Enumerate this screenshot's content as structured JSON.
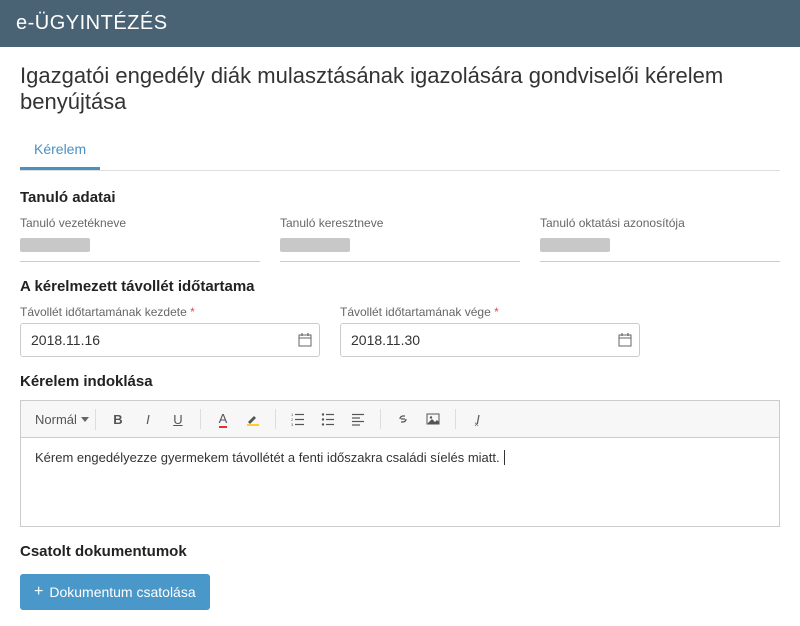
{
  "header": {
    "title": "e-ÜGYINTÉZÉS"
  },
  "page": {
    "title": "Igazgatói engedély diák mulasztásának igazolására gondviselői kérelem benyújtása"
  },
  "tabs": {
    "items": [
      {
        "label": "Kérelem",
        "active": true
      }
    ]
  },
  "student": {
    "section_title": "Tanuló adatai",
    "lastname_label": "Tanuló vezetékneve",
    "firstname_label": "Tanuló keresztneve",
    "eduId_label": "Tanuló oktatási azonosítója"
  },
  "absence": {
    "section_title": "A kérelmezett távollét időtartama",
    "start_label": "Távollét időtartamának kezdete",
    "end_label": "Távollét időtartamának vége",
    "start_value": "2018.11.16",
    "end_value": "2018.11.30"
  },
  "justification": {
    "section_title": "Kérelem indoklása",
    "format_dropdown": "Normál",
    "body_text": "Kérem engedélyezze gyermekem távollétét a fenti időszakra családi síelés miatt."
  },
  "attachments": {
    "section_title": "Csatolt dokumentumok",
    "attach_button": "Dokumentum csatolása"
  }
}
